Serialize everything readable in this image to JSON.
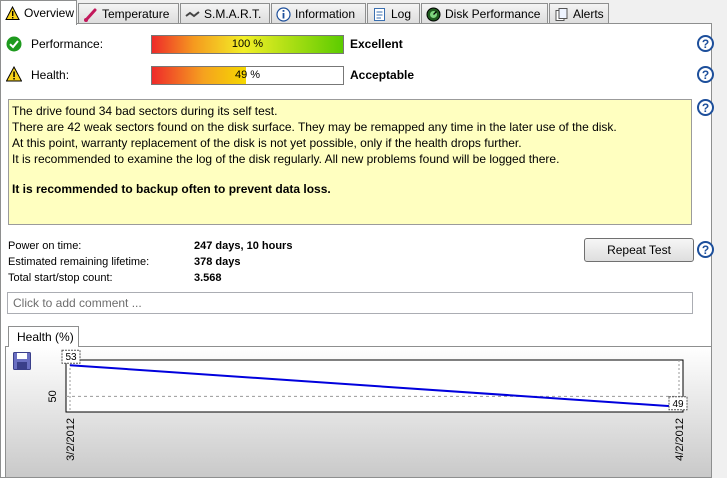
{
  "tabs": [
    {
      "label": "Overview",
      "icon": "warning-icon",
      "active": true
    },
    {
      "label": "Temperature",
      "icon": "thermometer-icon"
    },
    {
      "label": "S.M.A.R.T.",
      "icon": "smart-icon"
    },
    {
      "label": "Information",
      "icon": "info-icon"
    },
    {
      "label": "Log",
      "icon": "log-icon"
    },
    {
      "label": "Disk Performance",
      "icon": "gauge-icon"
    },
    {
      "label": "Alerts",
      "icon": "alerts-icon"
    }
  ],
  "performance": {
    "label": "Performance:",
    "value_text": "100 %",
    "value": 100,
    "rating": "Excellent",
    "status_icon": "check-icon"
  },
  "health": {
    "label": "Health:",
    "value_text": "49 %",
    "value": 49,
    "rating": "Acceptable",
    "status_icon": "warning-icon"
  },
  "message": {
    "lines": [
      "The drive found 34 bad sectors during its self test.",
      "There are 42 weak sectors found on the disk surface. They may be remapped any time in the later use of the disk.",
      "At this point, warranty replacement of the disk is not yet possible, only if the health drops further.",
      "It is recommended to examine the log of the disk regularly. All new problems found will be logged there."
    ],
    "emphasis": "It is recommended to backup often to prevent data loss."
  },
  "stats": [
    {
      "label": "Power on time:",
      "value": "247 days, 10 hours"
    },
    {
      "label": "Estimated remaining lifetime:",
      "value": "378 days"
    },
    {
      "label": "Total start/stop count:",
      "value": "3.568"
    }
  ],
  "repeat_test_label": "Repeat Test",
  "comment_placeholder": "Click to add comment ...",
  "chart_tab_label": "Health (%)",
  "colors": {
    "line": "#0000dd",
    "health_warning": "#f5d800",
    "performance_good": "#5ccc00"
  },
  "chart_data": {
    "type": "line",
    "x": [
      "3/2/2012",
      "4/2/2012"
    ],
    "series": [
      {
        "values": [
          53,
          49
        ]
      }
    ],
    "point_labels": [
      "53",
      "49"
    ],
    "yticks": [
      50
    ],
    "ylim": [
      48.5,
      53.5
    ],
    "grid": false
  }
}
